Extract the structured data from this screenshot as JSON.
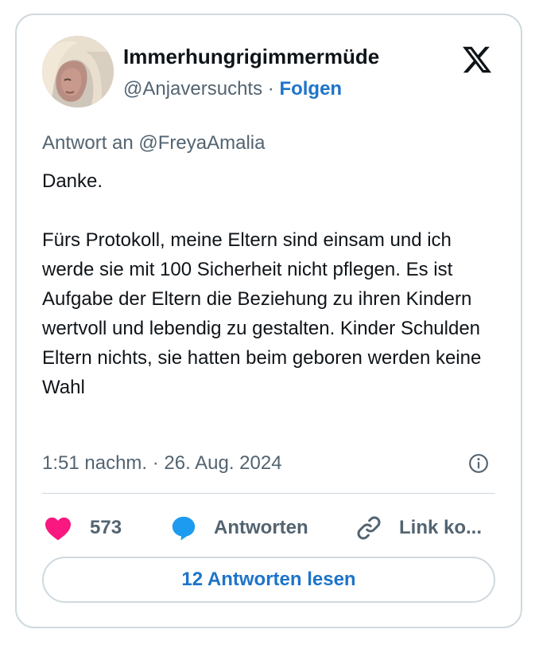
{
  "author": {
    "display_name": "Immerhungrigimmermüde",
    "handle": "@Anjaversuchts",
    "separator": " · ",
    "follow_label": "Folgen",
    "avatar_icon": "profile-photo"
  },
  "brand": {
    "logo_icon": "x-logo"
  },
  "tweet": {
    "reply_prefix": "Antwort an ",
    "reply_to": "@FreyaAmalia",
    "paragraphs": [
      "Danke.",
      "Fürs Protokoll, meine Eltern sind einsam und ich werde sie mit 100 Sicherheit nicht pflegen. Es ist Aufgabe der Eltern die Beziehung zu ihren Kindern wertvoll und lebendig zu gestalten. Kinder Schulden Eltern nichts, sie hatten beim geboren werden keine Wahl"
    ],
    "timestamp": "1:51 nachm. · 26. Aug. 2024"
  },
  "actions": {
    "like_count": "573",
    "reply_label": "Antworten",
    "link_label": "Link ko..."
  },
  "footer": {
    "read_replies_label": "12 Antworten lesen"
  },
  "colors": {
    "accent": "#1d74c9",
    "like": "#f91880",
    "reply": "#1d9bf0",
    "muted": "#536471",
    "border": "#cfd9de"
  }
}
